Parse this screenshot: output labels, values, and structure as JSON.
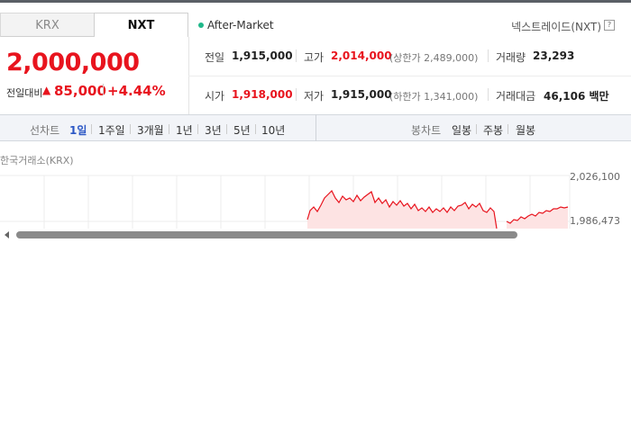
{
  "tabs": [
    {
      "label": "KRX",
      "active": false
    },
    {
      "label": "NXT",
      "active": true
    }
  ],
  "market_status": "After-Market",
  "exchange_name": "넥스트레이드(NXT)",
  "help_icon": "?",
  "price": {
    "current": "2,000,000",
    "change_label": "전일대비",
    "change_arrow": "▲",
    "change_value": "85,000",
    "change_pct": "+4.44%"
  },
  "stats": {
    "prev_close": {
      "label": "전일",
      "value": "1,915,000"
    },
    "high": {
      "label": "고가",
      "value": "2,014,000",
      "limit_label": "상한가",
      "limit_value": "2,489,000"
    },
    "volume": {
      "label": "거래량",
      "value": "23,293"
    },
    "open": {
      "label": "시가",
      "value": "1,918,000"
    },
    "low": {
      "label": "저가",
      "value": "1,915,000",
      "limit_label": "하한가",
      "limit_value": "1,341,000"
    },
    "amount": {
      "label": "거래대금",
      "value": "46,106",
      "unit": "백만"
    }
  },
  "toolbar": {
    "line_chart_label": "선차트",
    "periods": [
      "1일",
      "1주일",
      "3개월",
      "1년",
      "3년",
      "5년",
      "10년"
    ],
    "active_period": "1일",
    "candle_chart_label": "봉차트",
    "candle_periods": [
      "일봉",
      "주봉",
      "월봉"
    ]
  },
  "chart": {
    "source_label": "한국거래소(KRX)",
    "y_ticks": [
      "2,026,100",
      "1,986,473"
    ],
    "line_color": "#e8141e",
    "fill_color": "#fde3e3"
  }
}
